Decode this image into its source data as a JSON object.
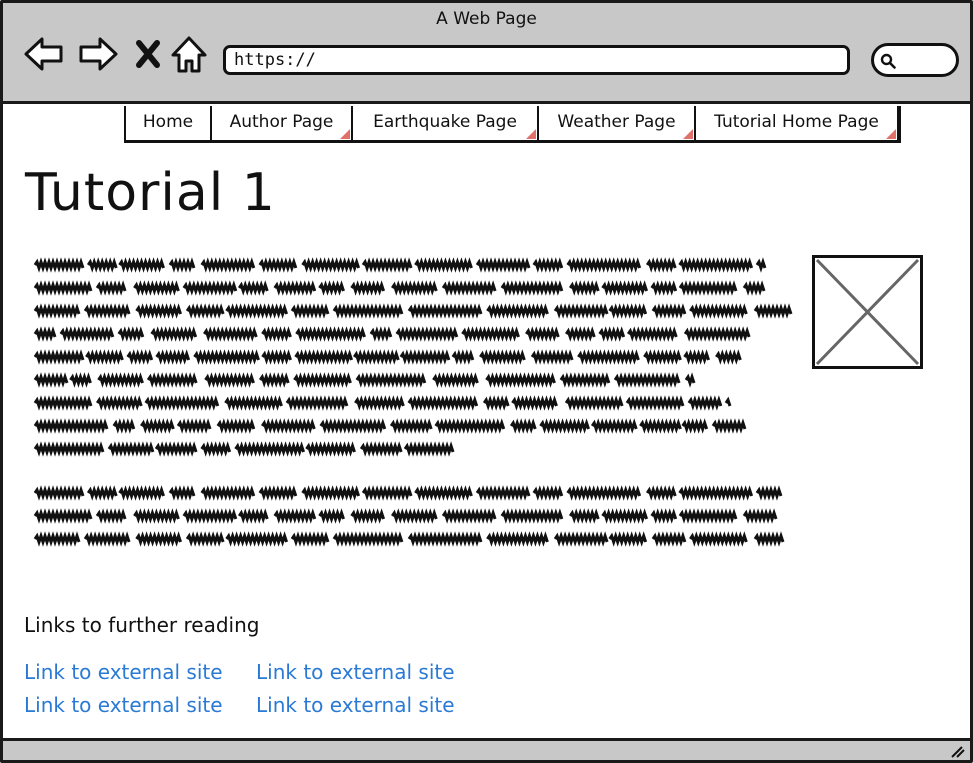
{
  "window": {
    "title": "A Web Page"
  },
  "address": {
    "url": "https://"
  },
  "tabs": [
    {
      "label": "Home"
    },
    {
      "label": "Author Page"
    },
    {
      "label": "Earthquake Page"
    },
    {
      "label": "Weather Page"
    },
    {
      "label": "Tutorial Home Page"
    }
  ],
  "page": {
    "title": "Tutorial 1"
  },
  "further": {
    "heading": "Links to further reading",
    "links": [
      "Link to external site",
      "Link to external site",
      "Link to external site",
      "Link to external site"
    ]
  },
  "colors": {
    "link": "#2a7ad5",
    "tab_corner": "#e0706a",
    "chrome": "#c8c8c8"
  }
}
